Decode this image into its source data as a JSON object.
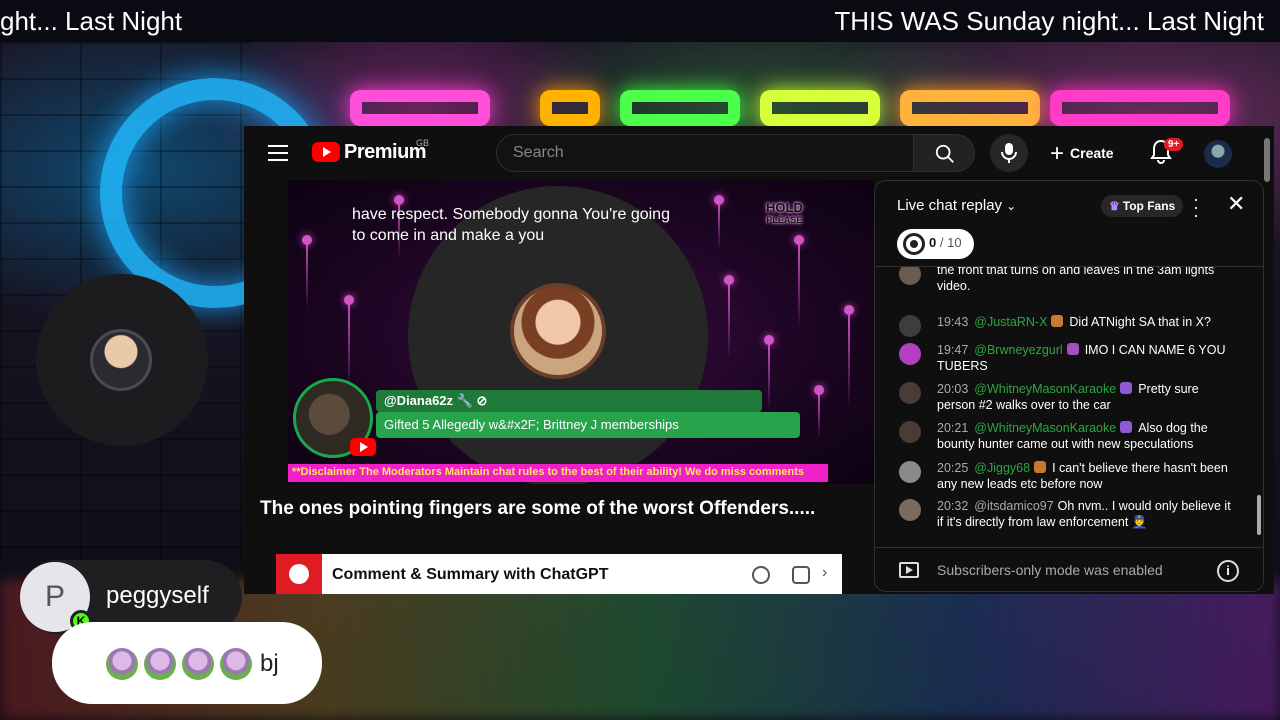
{
  "ticker": {
    "left_text": "ght... Last Night",
    "right_text": "THIS WAS Sunday night... Last Night"
  },
  "overlay": {
    "user_initial": "P",
    "badge_letter": "K",
    "username": "peggyself",
    "message_text": "bj",
    "emote_count": 4,
    "emote_icon": "avatar-emote-icon"
  },
  "youtube": {
    "brand": "Premium",
    "region": "GB",
    "search_placeholder": "Search",
    "create_label": "Create",
    "notification_badge": "9+",
    "video": {
      "caption": "have respect. Somebody gonna You're going to come in and make a you",
      "hold_top": "HOLD",
      "hold_bottom": "PLEASE",
      "gift_user": "@Diana62z 🔧 ⊘",
      "gift_message": "Gifted 5 Allegedly w&#x2F; Brittney J memberships",
      "disclaimer": "**Disclaimer The Moderators Maintain chat rules to the best of their ability! We do miss comments"
    },
    "title": "The ones pointing fingers are some of the worst Offenders.....",
    "extension": {
      "label": "Comment & Summary with ChatGPT"
    },
    "chat": {
      "title": "Live chat replay",
      "top_fans": "Top Fans",
      "goal_current": "0",
      "goal_total": "/ 10",
      "footer": "Subscribers-only mode was enabled",
      "messages": [
        {
          "time": "",
          "author": "",
          "text": "the front that turns on and leaves in the 3am lights video.",
          "author_color": "#2ba640"
        },
        {
          "time": "19:43",
          "author": "@JustaRN-X",
          "text": "Did ATNight SA that in X?",
          "author_color": "#2ba640"
        },
        {
          "time": "19:47",
          "author": "@Brwneyezgurl",
          "text": "IMO I CAN NAME 6 YOU TUBERS",
          "author_color": "#2ba640"
        },
        {
          "time": "20:03",
          "author": "@WhitneyMasonKaraoke",
          "text": "Pretty sure person #2 walks over to the car",
          "author_color": "#2ba640"
        },
        {
          "time": "20:21",
          "author": "@WhitneyMasonKaraoke",
          "text": "Also dog the bounty hunter came out with new speculations",
          "author_color": "#2ba640"
        },
        {
          "time": "20:25",
          "author": "@Jiggy68",
          "text": "I can't believe there hasn't been any new leads etc before now",
          "author_color": "#2ba640"
        },
        {
          "time": "20:32",
          "author": "@itsdamico97",
          "text": "Oh nvm.. I would only believe it if it's directly from law enforcement 👮",
          "author_color": "#aaaaaa"
        }
      ]
    }
  }
}
